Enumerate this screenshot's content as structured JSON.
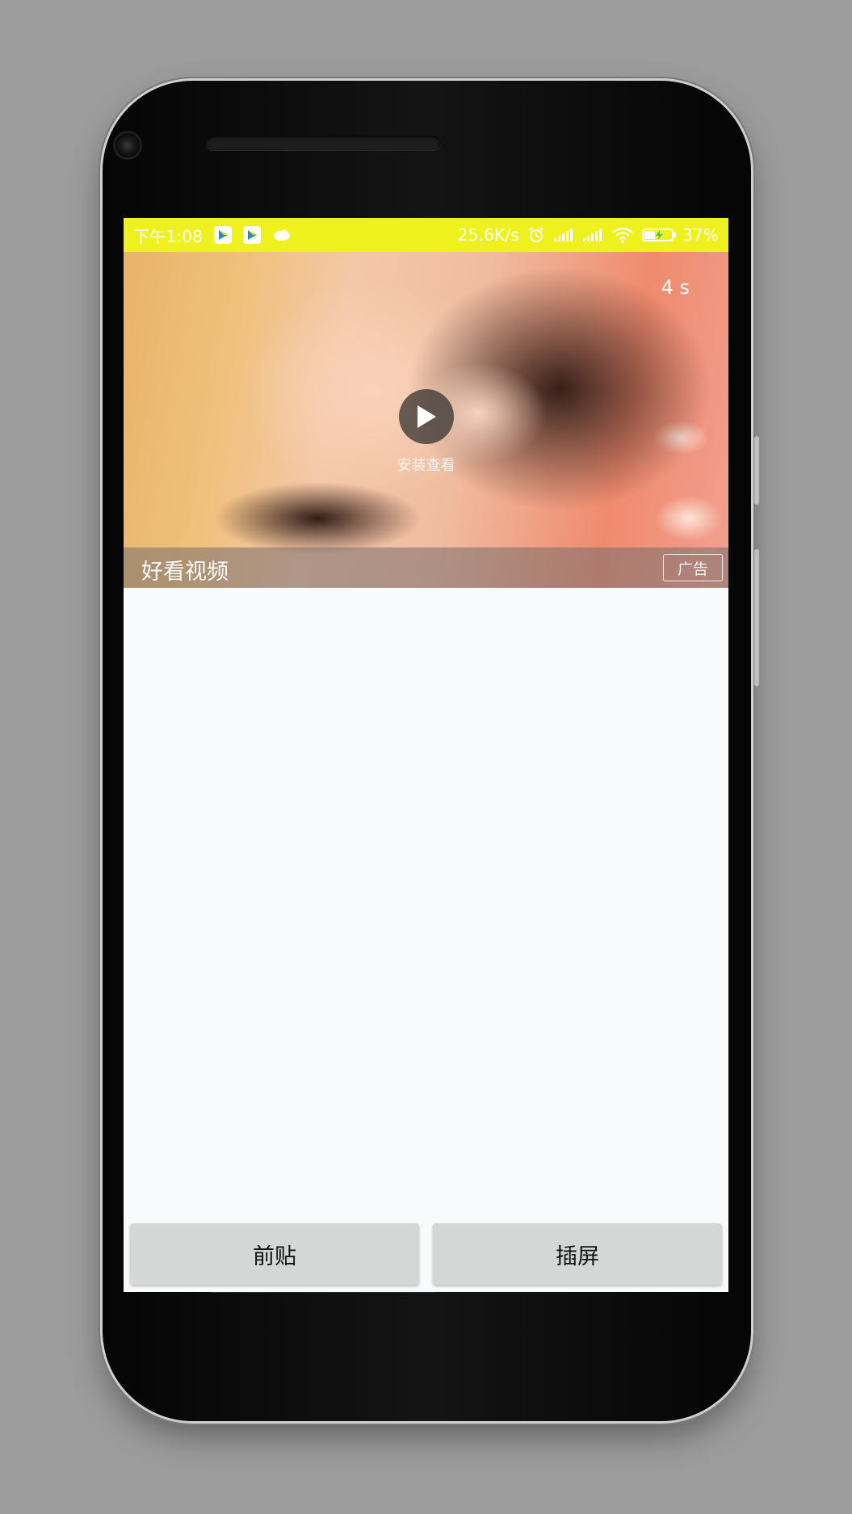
{
  "status_bar": {
    "time": "下午1:08",
    "net_speed": "25.6K/s",
    "battery": "37%",
    "background_color": "#eef11d",
    "left_icons": [
      "video-app-icon",
      "video-app-icon",
      "cloud-icon"
    ],
    "right_icons": [
      "alarm-icon",
      "signal-icon",
      "signal-icon",
      "wifi-icon",
      "battery-charging-icon"
    ]
  },
  "ad": {
    "countdown": "4 s",
    "install_label": "安装查看",
    "title": "好看视频",
    "badge": "广告",
    "play_icon": "play-icon"
  },
  "buttons": {
    "preroll": "前贴",
    "interstitial": "插屏"
  }
}
